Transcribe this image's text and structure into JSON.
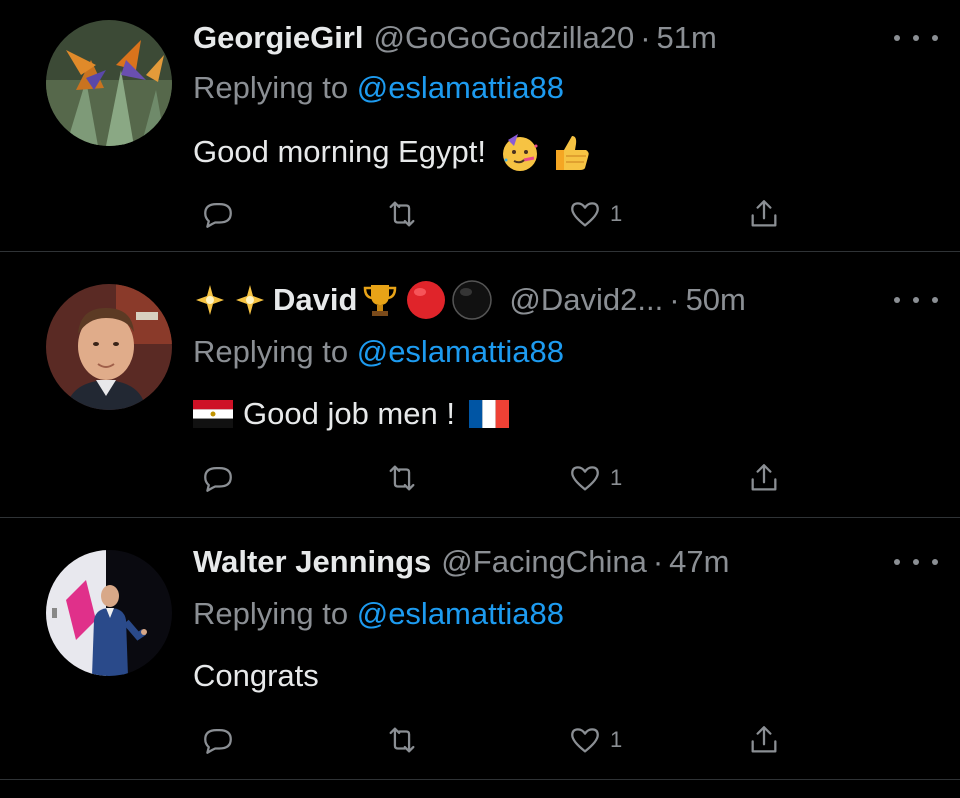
{
  "tweets": [
    {
      "display_name": "GeorgieGirl",
      "handle": "@GoGoGodzilla20",
      "separator": "·",
      "time": "51m",
      "replying_prefix": "Replying to",
      "replying_to": "@eslamattia88",
      "text": "Good morning Egypt!",
      "emojis": [
        "partying-face-emoji",
        "thumbs-up-emoji"
      ],
      "like_count": "1",
      "avatar": "bird-of-paradise-flower"
    },
    {
      "name_prefix_emojis": [
        "sparkle-star-emoji",
        "sparkle-star-emoji"
      ],
      "display_name": "David",
      "name_suffix_emojis": [
        "trophy-emoji",
        "red-circle-emoji",
        "black-circle-emoji"
      ],
      "handle": "@David2...",
      "separator": "·",
      "time": "50m",
      "replying_prefix": "Replying to",
      "replying_to": "@eslamattia88",
      "text": "Good job men !",
      "emojis": [
        "egypt-flag-emoji",
        "france-flag-emoji"
      ],
      "like_count": "1",
      "avatar": "man-portrait"
    },
    {
      "display_name": "Walter Jennings",
      "handle": "@FacingChina",
      "separator": "·",
      "time": "47m",
      "replying_prefix": "Replying to",
      "replying_to": "@eslamattia88",
      "text": "Congrats",
      "emojis": [],
      "like_count": "1",
      "avatar": "speaker-on-stage"
    }
  ],
  "colors": {
    "background": "#000000",
    "primary_text": "#e7e9ea",
    "secondary_text": "#8b8f94",
    "link": "#1d9bf0",
    "divider": "#2f3336"
  },
  "icons": [
    "reply-icon",
    "retweet-icon",
    "like-icon",
    "share-icon",
    "more-icon"
  ]
}
